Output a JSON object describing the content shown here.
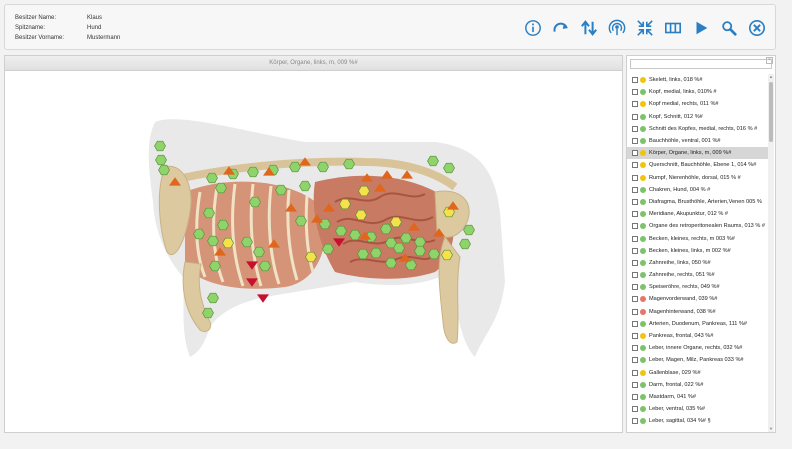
{
  "header": {
    "rows": [
      {
        "label": "Besitzer Name:",
        "value": "Klaus"
      },
      {
        "label": "Spitzname:",
        "value": "Hund"
      },
      {
        "label": "Besitzer Vorname:",
        "value": "Mustermann"
      }
    ],
    "accent_color": "#2a7fc4"
  },
  "viewer": {
    "title": "Körper, Organe, links, m, 009 %#"
  },
  "search": {
    "placeholder": "",
    "value": ""
  },
  "list": [
    {
      "label": "Skelett, links, 018 %#",
      "color": "#f1c40f"
    },
    {
      "label": "Kopf, medial, links, 010% #",
      "color": "#7cc36b"
    },
    {
      "label": "Kopf medial, rechts, 011 %#",
      "color": "#f1c40f"
    },
    {
      "label": "Kopf, Schnitt, 012 %#",
      "color": "#7cc36b"
    },
    {
      "label": "Schnitt des Kopfes, medial, rechts, 016 % #",
      "color": "#7cc36b"
    },
    {
      "label": "Bauchhöhle, ventral, 001 %#",
      "color": "#7cc36b"
    },
    {
      "label": "Körper, Organe, links, m, 009 %#",
      "color": "#f1c40f"
    },
    {
      "label": "Querschnitt, Bauchhöhle, Ebene 1, 014 %#",
      "color": "#f1c40f"
    },
    {
      "label": "Rumpf, Nierenhöhle, dorsal, 015 % #",
      "color": "#f1c40f"
    },
    {
      "label": "Chakren, Hund, 004 % #",
      "color": "#7cc36b"
    },
    {
      "label": "Diafragma, Brusthöhle, Arterien,Venen 005 %",
      "color": "#7cc36b"
    },
    {
      "label": "Meridiane, Akupunktur, 012 % #",
      "color": "#7cc36b"
    },
    {
      "label": "Organe des retroperitonealen Raums, 013 % #",
      "color": "#7cc36b"
    },
    {
      "label": "Becken, kleines, rechts, m 003 %#",
      "color": "#7cc36b"
    },
    {
      "label": "Becken, kleines, links, m 002 %#",
      "color": "#7cc36b"
    },
    {
      "label": "Zahnreihe, links, 050 %#",
      "color": "#7cc36b"
    },
    {
      "label": "Zahnreihe, rechts, 051 %#",
      "color": "#7cc36b"
    },
    {
      "label": "Speiseröhre, rechts, 049 %#",
      "color": "#7cc36b"
    },
    {
      "label": "Magenvorderwand, 039 %#",
      "color": "#e8746a"
    },
    {
      "label": "Magenhinterwand, 038 %#",
      "color": "#e8746a"
    },
    {
      "label": "Arterien, Duodenum, Pankreas, 111 %#",
      "color": "#7cc36b"
    },
    {
      "label": "Pankreas, frontal, 043 %#",
      "color": "#f1c40f"
    },
    {
      "label": "Leber, innere Organe, rechts, 032 %#",
      "color": "#7cc36b"
    },
    {
      "label": "Leber, Magen, Milz, Pankreas 033 %#",
      "color": "#7cc36b"
    },
    {
      "label": "Gallenblase, 029 %#",
      "color": "#f1c40f"
    },
    {
      "label": "Darm, frontal, 022 %#",
      "color": "#7cc36b"
    },
    {
      "label": "Mastdarm, 041 %#",
      "color": "#7cc36b"
    },
    {
      "label": "Leber, ventral, 035 %#",
      "color": "#7cc36b"
    },
    {
      "label": "Leber, sagittal, 034 %# §",
      "color": "#7cc36b"
    }
  ],
  "selected_index": 6,
  "markers": {
    "green_color": "#8fd36b",
    "yellow_color": "#f5e24a",
    "orange_color": "#e0661c",
    "red_color": "#c8102e"
  }
}
